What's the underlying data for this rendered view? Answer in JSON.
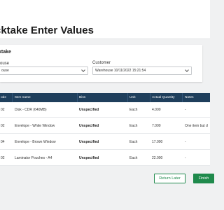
{
  "page": {
    "title": "cktake Enter Values"
  },
  "card": {
    "title": "ktake",
    "warehouse": {
      "label": "ouse",
      "value": "ouse"
    },
    "customer": {
      "label": "Customer",
      "value": "Warehouse 10/11/2022 15:21:54"
    }
  },
  "table": {
    "headers": [
      "ode",
      "Item name",
      "Bins",
      "Unit",
      "Actual Quantity",
      "Notes"
    ],
    "rows": [
      {
        "code": "02",
        "name": "Disk - CDR (640MB)",
        "bins": "Unspecified",
        "unit": "Each",
        "qty": "4.000",
        "notes": "-"
      },
      {
        "code": "02",
        "name": "Envelope - White Window",
        "bins": "Unspecified",
        "unit": "Each",
        "qty": "7.000",
        "notes": "One item but d"
      },
      {
        "code": "04",
        "name": "Envelope - Brown Window",
        "bins": "Unspecified",
        "unit": "Each",
        "qty": "17.000",
        "notes": "-"
      },
      {
        "code": "02",
        "name": "Laminator Pouches - A4",
        "bins": "Unspecified",
        "unit": "Each",
        "qty": "22.000",
        "notes": "-"
      }
    ]
  },
  "actions": {
    "return_label": "Return Later",
    "finish_label": "Finish"
  },
  "colors": {
    "header_bg": "#1f3f5c",
    "accent": "#1f8a4c"
  }
}
